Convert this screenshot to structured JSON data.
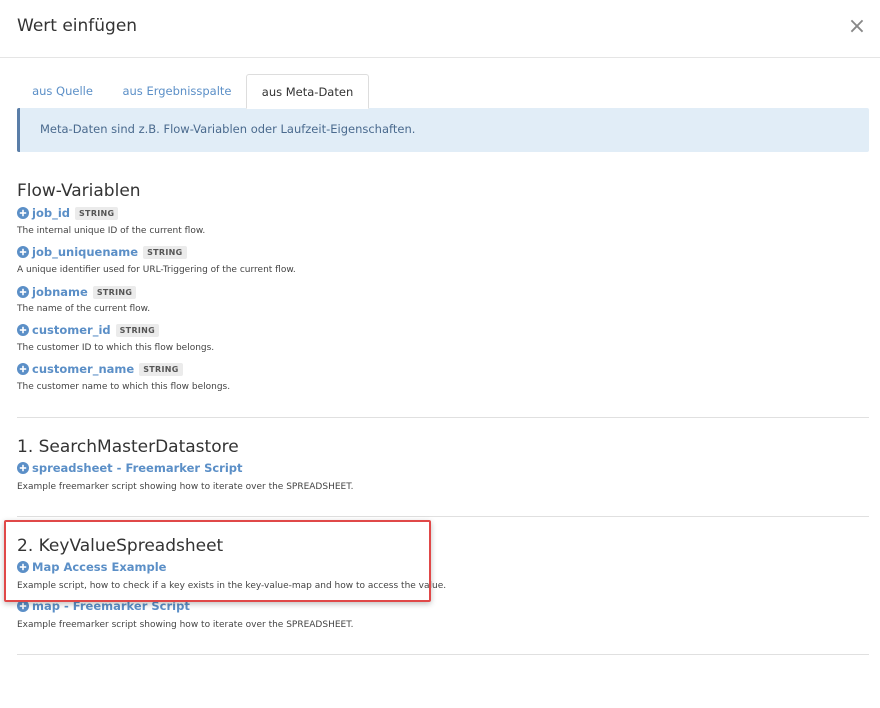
{
  "modal": {
    "title": "Wert einfügen",
    "close_label": "×"
  },
  "tabs": [
    {
      "label": "aus Quelle",
      "active": false
    },
    {
      "label": "aus Ergebnisspalte",
      "active": false
    },
    {
      "label": "aus Meta-Daten",
      "active": true
    }
  ],
  "info": {
    "text": "Meta-Daten sind z.B. Flow-Variablen oder Laufzeit-Eigenschaften."
  },
  "sections": [
    {
      "title": "Flow-Variablen",
      "items": [
        {
          "name": "job_id",
          "type": "STRING",
          "description": "The internal unique ID of the current flow."
        },
        {
          "name": "job_uniquename",
          "type": "STRING",
          "description": "A unique identifier used for URL-Triggering of the current flow."
        },
        {
          "name": "jobname",
          "type": "STRING",
          "description": "The name of the current flow."
        },
        {
          "name": "customer_id",
          "type": "STRING",
          "description": "The customer ID to which this flow belongs."
        },
        {
          "name": "customer_name",
          "type": "STRING",
          "description": "The customer name to which this flow belongs."
        }
      ]
    },
    {
      "title": "1. SearchMasterDatastore",
      "items": [
        {
          "name": "spreadsheet - Freemarker Script",
          "description": "Example freemarker script showing how to iterate over the SPREADSHEET."
        }
      ]
    },
    {
      "title": "2. KeyValueSpreadsheet",
      "items": [
        {
          "name": "Map Access Example",
          "description": "Example script, how to check if a key exists in the key-value-map and how to access the value."
        },
        {
          "name": "map - Freemarker Script",
          "description": "Example freemarker script showing how to iterate over the SPREADSHEET."
        }
      ]
    }
  ],
  "colors": {
    "link": "#5b8fc7",
    "info_bg": "#e1edf7",
    "highlight": "#e04848"
  },
  "icons": {
    "add": "plus-circle-icon",
    "close": "close-icon"
  }
}
